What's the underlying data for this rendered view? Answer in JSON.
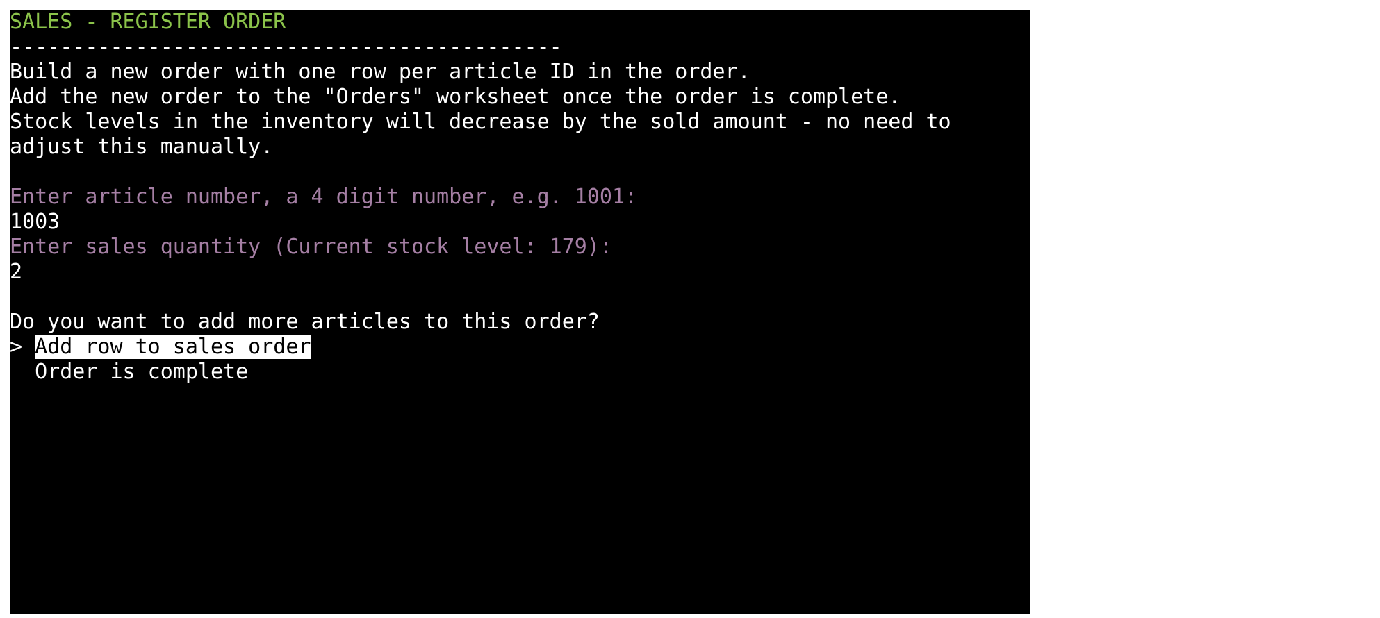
{
  "terminal": {
    "title": "SALES - REGISTER ORDER",
    "separator": "--------------------------------------------",
    "description": [
      "Build a new order with one row per article ID in the order.",
      "Add the new order to the \"Orders\" worksheet once the order is complete.",
      "Stock levels in the inventory will decrease by the sold amount - no need to",
      "adjust this manually."
    ],
    "article_prompt": "Enter article number, a 4 digit number, e.g. 1001:",
    "article_input": "1003",
    "quantity_prompt": "Enter sales quantity (Current stock level: 179):",
    "quantity_input": "2",
    "question": "Do you want to add more articles to this order?",
    "cursor": ">",
    "options": [
      "Add row to sales order",
      "Order is complete"
    ]
  },
  "colors": {
    "background": "#000000",
    "text": "#ffffff",
    "title": "#8bc34a",
    "prompt": "#a57fa4",
    "highlight_bg": "#ffffff",
    "highlight_fg": "#000000"
  }
}
